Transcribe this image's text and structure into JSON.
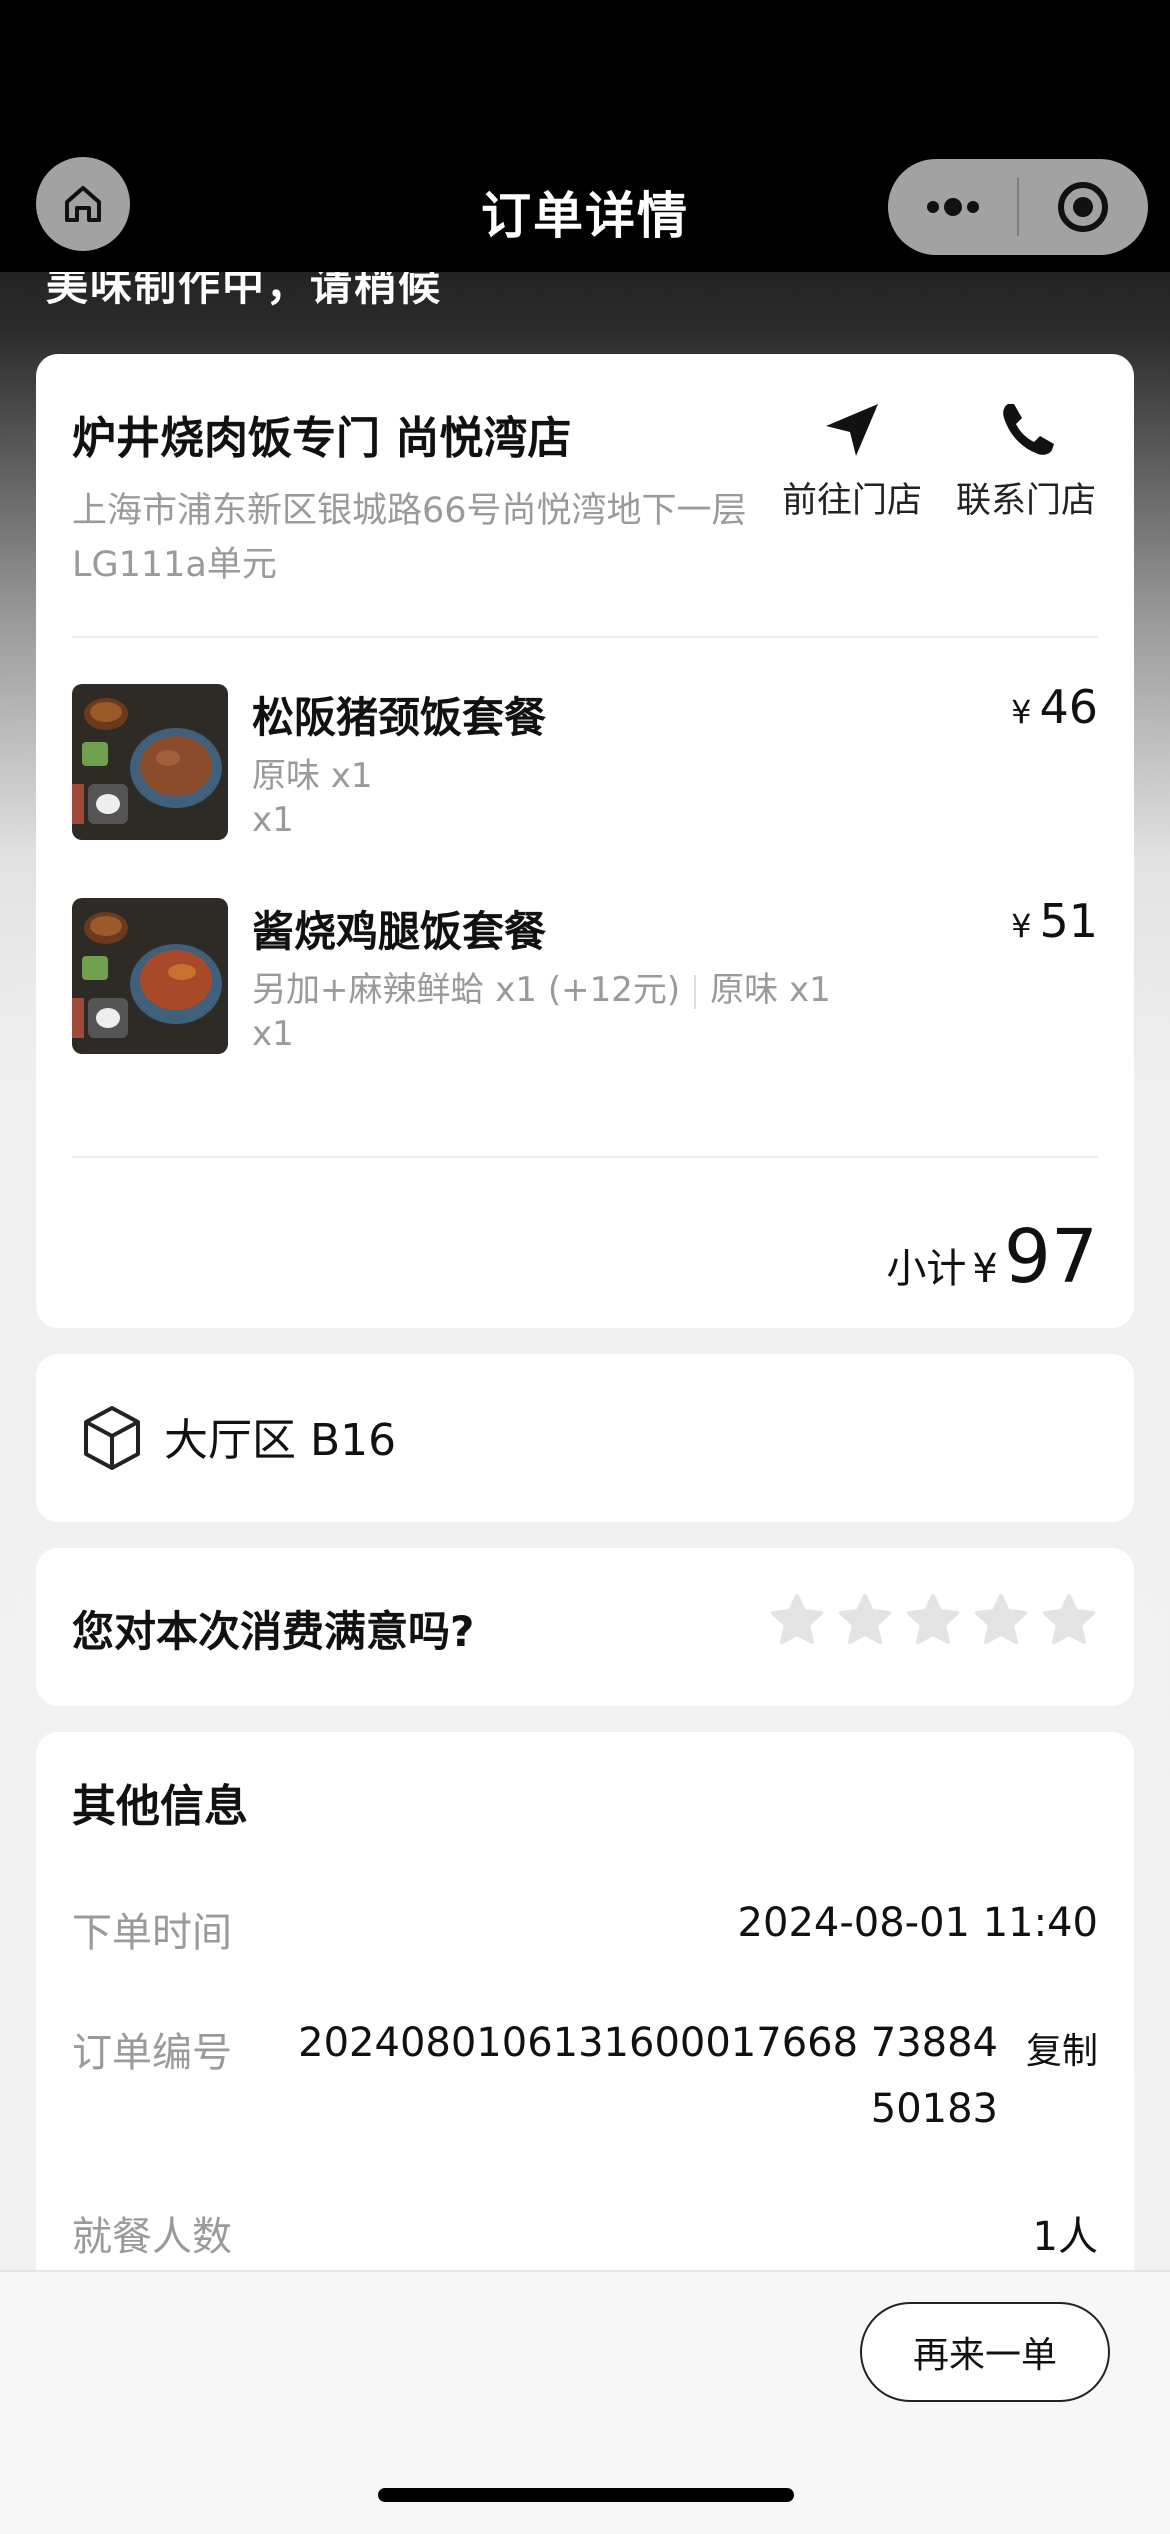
{
  "header": {
    "title": "订单详情"
  },
  "status_partial": "美味制作中，请稍候",
  "store": {
    "name": "炉井烧肉饭专门 尚悦湾店",
    "address": "上海市浦东新区银城路66号尚悦湾地下一层LG111a单元",
    "navigate_label": "前往门店",
    "call_label": "联系门店"
  },
  "items": [
    {
      "name": "松阪猪颈饭套餐",
      "options": "原味 x1",
      "qty": "x1",
      "currency": "¥",
      "price": "46"
    },
    {
      "name": "酱烧鸡腿饭套餐",
      "option_a": "另加+麻辣鲜蛤 x1 (+12元)",
      "option_b": "原味 x1",
      "qty": "x1",
      "currency": "¥",
      "price": "51"
    }
  ],
  "subtotal": {
    "label": "小计",
    "currency": "¥",
    "amount": "97"
  },
  "table": {
    "label": "大厅区 B16"
  },
  "rating": {
    "question": "您对本次消费满意吗?",
    "stars_selected": 0,
    "stars_total": 5
  },
  "info": {
    "title": "其他信息",
    "order_time_label": "下单时间",
    "order_time": "2024-08-01 11:40",
    "order_no_label": "订单编号",
    "order_no": "2024080106131600017668 7388450183",
    "copy_label": "复制",
    "diners_label": "就餐人数",
    "diners": "1人"
  },
  "footer": {
    "reorder_label": "再来一单"
  },
  "colors": {
    "card": "#ffffff",
    "muted_text": "#9a9a9a",
    "star_empty": "#e3e3e3"
  }
}
